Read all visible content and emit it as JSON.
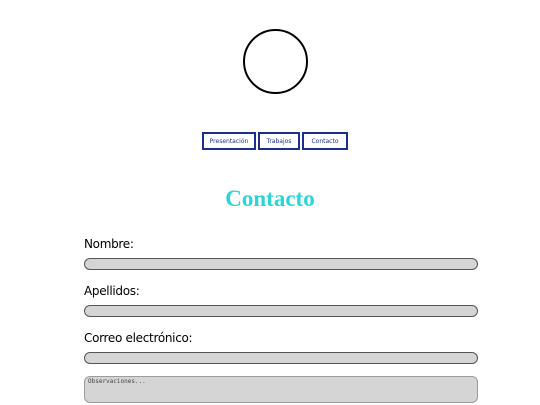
{
  "nav": {
    "items": [
      {
        "label": "Presentación"
      },
      {
        "label": "Trabajos"
      },
      {
        "label": "Contacto"
      }
    ],
    "border_color": "#1a2f8f"
  },
  "main": {
    "title": "Contacto",
    "title_color": "#2ad4d8"
  },
  "form": {
    "nombre_label": "Nombre:",
    "nombre_value": "",
    "apellidos_label": "Apellidos:",
    "apellidos_value": "",
    "correo_label": "Correo electrónico:",
    "correo_value": "",
    "observaciones_placeholder": "Observaciones...",
    "input_fill_color": "#d5d5d5"
  },
  "logo": {
    "icon": "circle-logo-icon"
  }
}
